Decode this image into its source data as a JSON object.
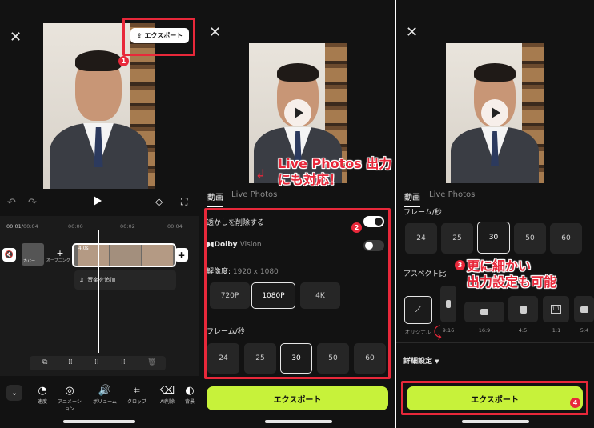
{
  "panel1": {
    "export_button": "エクスポート",
    "badge": "1",
    "time_current": "00:01",
    "time_total": "00:04",
    "ruler": [
      "00:00",
      "00:02",
      "00:04"
    ],
    "cover_label": "カバー",
    "opening_label": "オープニング",
    "clip_duration": "4.0s",
    "add_music": "音楽を追加",
    "tools": [
      {
        "icon": "speed-icon",
        "glyph": "◔",
        "label": "速度"
      },
      {
        "icon": "animation-icon",
        "glyph": "◎",
        "label": "アニメーション"
      },
      {
        "icon": "volume-icon",
        "glyph": "🔊",
        "label": "ボリューム"
      },
      {
        "icon": "crop-icon",
        "glyph": "⌗",
        "label": "クロップ"
      },
      {
        "icon": "ai-erase-icon",
        "glyph": "⌫",
        "label": "AI削除"
      },
      {
        "icon": "background-icon",
        "glyph": "◐",
        "label": "背景"
      }
    ]
  },
  "panel2": {
    "annotation": "Live Photos 出力\nにも対応！",
    "tab_video": "動画",
    "tab_live": "Live Photos",
    "remove_watermark": "透かしを削除する",
    "dolby": "Dolby",
    "dolby_vision": "Vision",
    "resolution_label": "解像度:",
    "resolution_value": "1920 x 1080",
    "resolutions": [
      "720P",
      "1080P",
      "4K"
    ],
    "frame_label": "フレーム/秒",
    "frames": [
      "24",
      "25",
      "30",
      "50",
      "60"
    ],
    "badge": "2",
    "export": "エクスポート"
  },
  "panel3": {
    "tab_video": "動画",
    "tab_live": "Live Photos",
    "frame_label": "フレーム/秒",
    "frames": [
      "24",
      "25",
      "30",
      "50",
      "60"
    ],
    "aspect_label": "アスペクト比",
    "annotation": "更に細かい\n出力設定も可能",
    "badge3": "3",
    "ratios": [
      "オリジナル",
      "9:16",
      "16:9",
      "4:5",
      "1:1",
      "5:4"
    ],
    "ratio_icons": [
      "1:1"
    ],
    "details": "詳細設定",
    "export": "エクスポート",
    "badge4": "4"
  },
  "colors": {
    "accent": "#c7f23a",
    "annotation_red": "#e8283a",
    "bg": "#121212"
  }
}
